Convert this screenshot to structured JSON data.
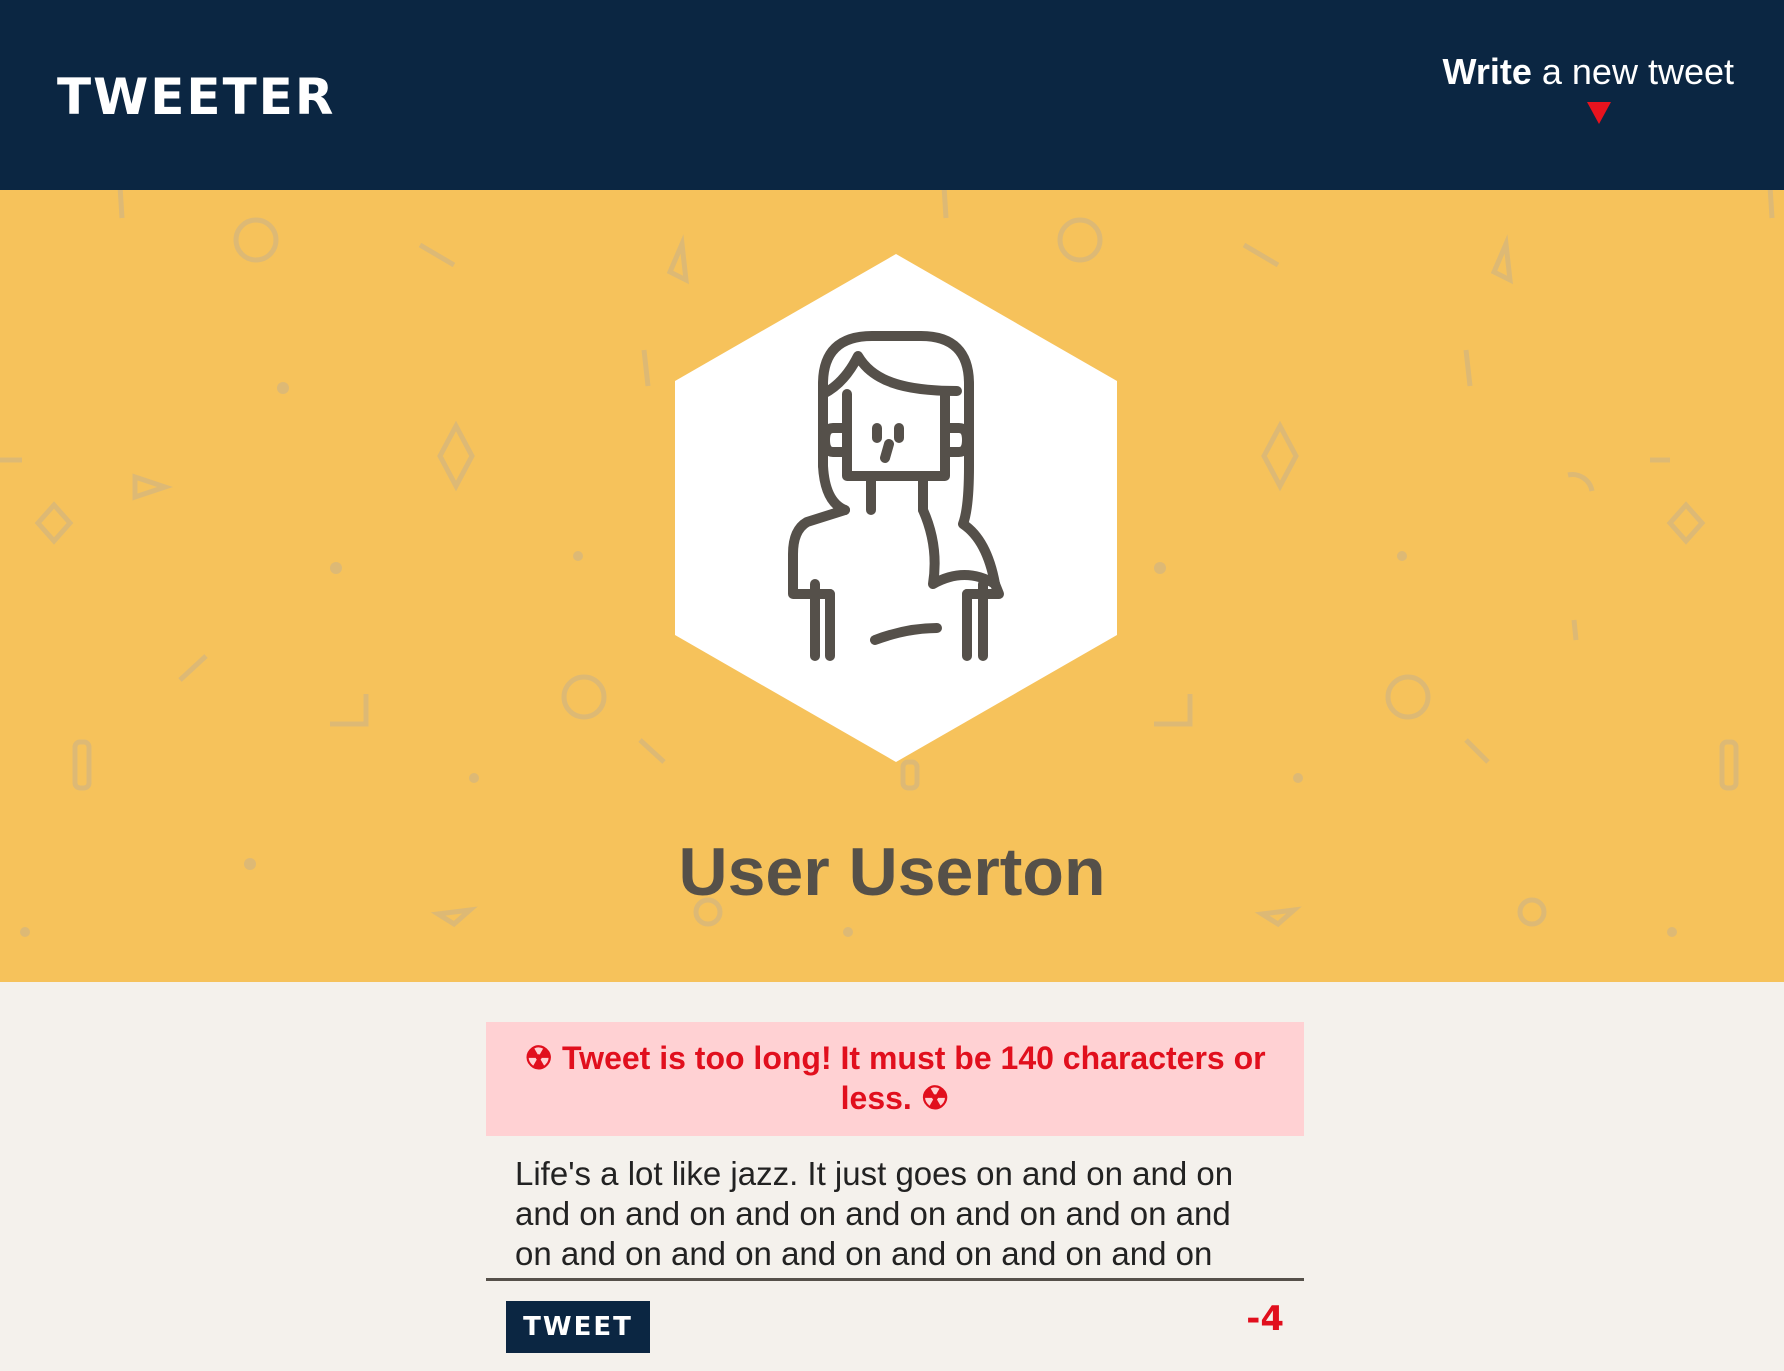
{
  "header": {
    "brand": "TWEETER",
    "compose_toggle_bold": "Write",
    "compose_toggle_rest": " a new tweet",
    "arrow_icon": "caret-down-icon"
  },
  "profile": {
    "name": "User Userton",
    "avatar_icon": "woman-avatar-icon"
  },
  "composer": {
    "error_icon": "☢",
    "error_message": "Tweet is too long! It must be 140 characters or less.",
    "tweet_text": "Life's a lot like jazz. It just goes on and on and on and on and on and on and on and on and on and on and on and on and on and on and on and on and on and o-",
    "button_label": "TWEET",
    "char_counter": "-4"
  },
  "colors": {
    "navbar": "#0b2642",
    "hero": "#f6c25b",
    "error_text": "#e10f1d",
    "error_bg": "#ffd1d3"
  }
}
